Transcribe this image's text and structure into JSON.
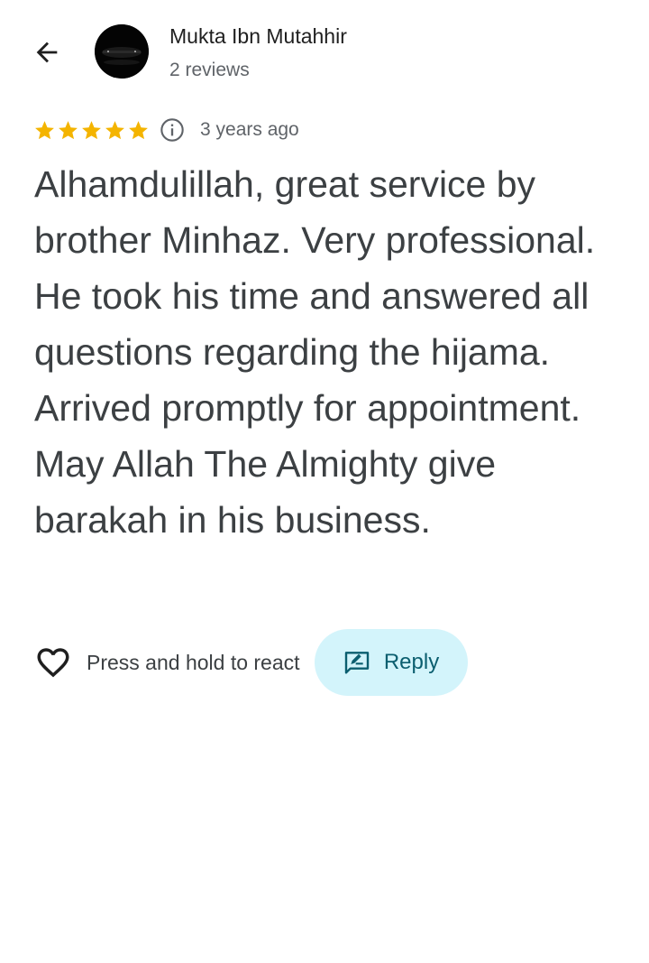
{
  "reviewer": {
    "name": "Mukta Ibn Mutahhir",
    "review_count": "2 reviews",
    "avatar_icon": "avatar"
  },
  "rating": {
    "stars": 5,
    "max_stars": 5,
    "star_color": "#f4b400",
    "time_ago": "3 years ago"
  },
  "review": {
    "text": "Alhamdulillah, great service by brother Minhaz. Very professional. He took his time and answered all questions regarding the hijama. Arrived promptly for appointment. May Allah The Almighty give barakah in his business."
  },
  "actions": {
    "react_label": "Press and hold to react",
    "reply_label": "Reply",
    "reply_bg": "#d3f4fb",
    "reply_text_color": "#0b5e6f"
  },
  "icons": {
    "back": "back-arrow-icon",
    "info": "info-icon",
    "heart": "heart-icon",
    "reply": "reply-icon"
  }
}
